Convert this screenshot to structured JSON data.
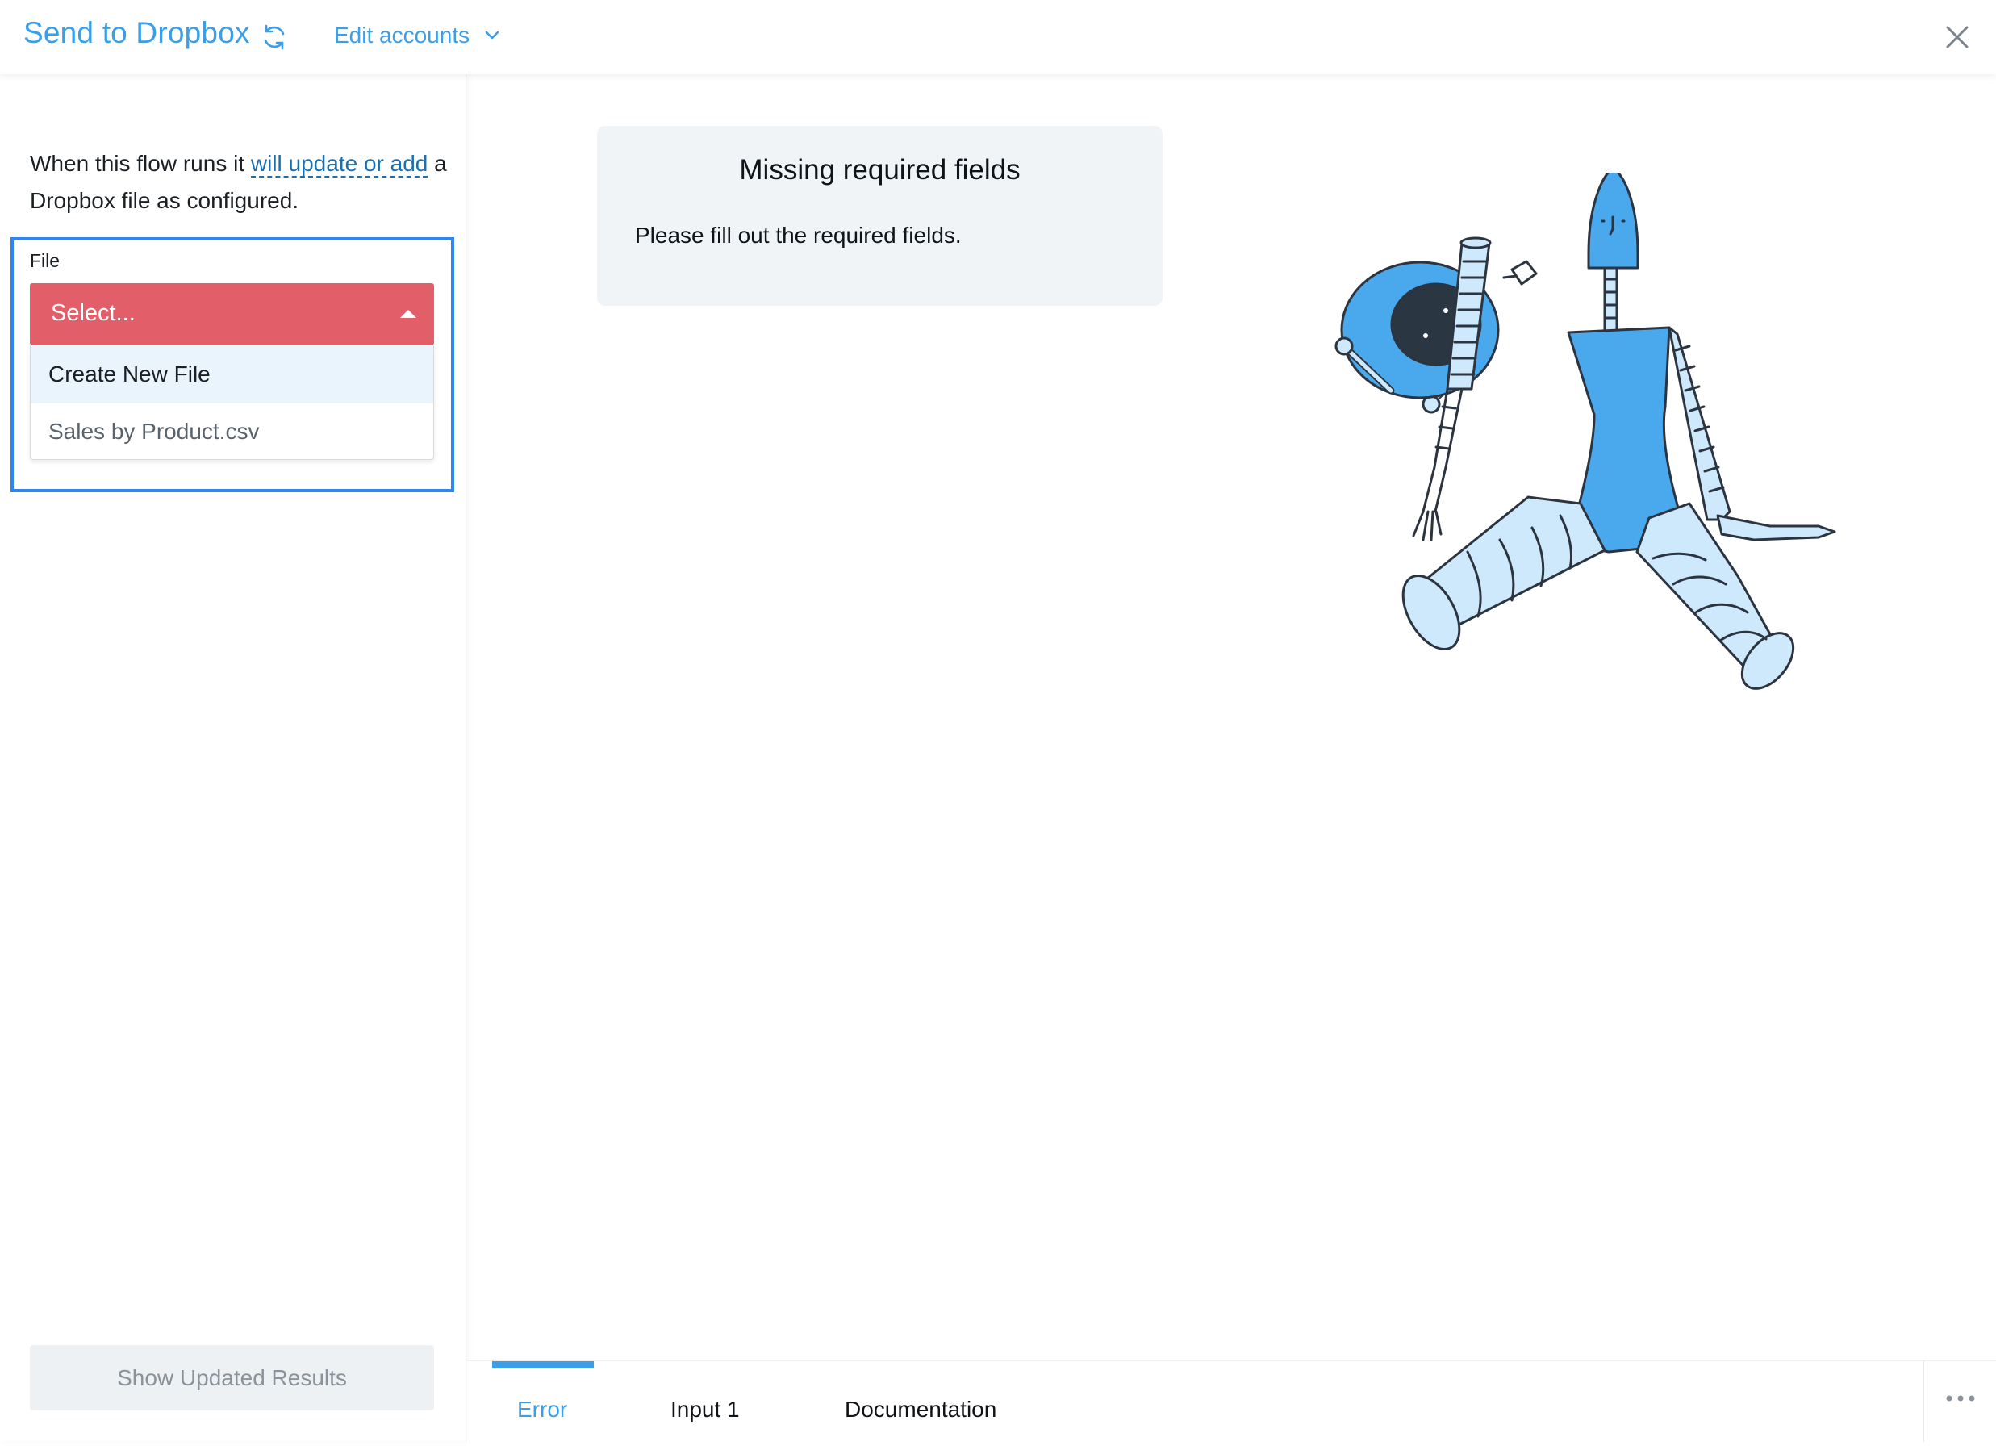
{
  "header": {
    "title": "Send to Dropbox",
    "edit_accounts": "Edit accounts",
    "icons": [
      "refresh-icon",
      "chevron-down-icon",
      "close-icon"
    ]
  },
  "sidebar": {
    "intro_text_before": "When this flow runs it ",
    "intro_link": "will update or add",
    "intro_text_after": " a Dropbox file as configured.",
    "file_label": "File",
    "select": {
      "value": "Select...",
      "expanded": true,
      "options": [
        "Create New File",
        "Sales by Product.csv"
      ],
      "highlighted_option": "Create New File"
    },
    "show_results_button": "Show Updated Results"
  },
  "main": {
    "alert": {
      "title": "Missing required fields",
      "body": "Please fill out the required fields."
    },
    "illustration": "robot-illustration"
  },
  "tabs": {
    "items": [
      "Error",
      "Input 1",
      "Documentation"
    ],
    "active": "Error",
    "more_icon": "more-horizontal-icon"
  },
  "colors": {
    "accent": "#3b9ee8",
    "error": "#e25f6a",
    "focus": "#2e86f0",
    "link": "#1a6fb0",
    "robot_blue": "#4aa8ec",
    "robot_light": "#cde9fb"
  }
}
